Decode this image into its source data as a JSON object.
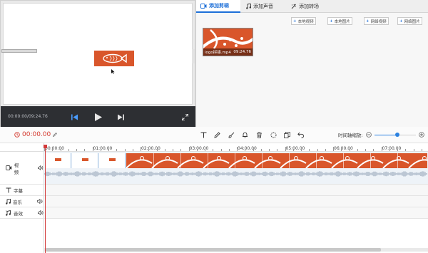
{
  "preview": {
    "timecode": "00:00:00/09:24.76"
  },
  "media_panel": {
    "tabs": [
      {
        "label": "添加剪辑",
        "icon": "video-icon",
        "active": true
      },
      {
        "label": "添加声音",
        "icon": "music-note-icon",
        "active": false
      },
      {
        "label": "添加转场",
        "icon": "transition-icon",
        "active": false
      }
    ],
    "source_buttons": [
      {
        "label": "本地视频",
        "icon": "plus-icon"
      },
      {
        "label": "本地图片",
        "icon": "plus-icon"
      },
      {
        "label": "网络视频",
        "icon": "plus-icon"
      },
      {
        "label": "网络图片",
        "icon": "plus-icon"
      }
    ],
    "clip": {
      "name": "logo拼接.mp4",
      "duration": "09:24.76"
    }
  },
  "toolbar": {
    "current_time": "00:00.00",
    "tools": [
      "text-icon",
      "pen-icon",
      "brush-icon",
      "bell-icon",
      "delete-icon",
      "crop-icon",
      "copy-icon",
      "undo-icon"
    ],
    "zoom_label": "时间轴缩放:",
    "zoom_level": 0.55,
    "accent_color": "#d43a2f"
  },
  "timeline": {
    "ruler_ticks": [
      "00:00:00",
      "01:00.00",
      "02:00.00",
      "03:00.00",
      "04:00.00",
      "05:00.00",
      "06:00.00",
      "07:00.00"
    ],
    "tracks": [
      {
        "label": "视频",
        "icon": "video-icon"
      },
      {
        "label": "字幕",
        "icon": "text-icon"
      },
      {
        "label": "音乐",
        "icon": "music-note-icon"
      },
      {
        "label": "音效",
        "icon": "sound-effect-icon"
      }
    ],
    "playhead_color": "#d33a3a",
    "clip_color": "#d9562b"
  }
}
